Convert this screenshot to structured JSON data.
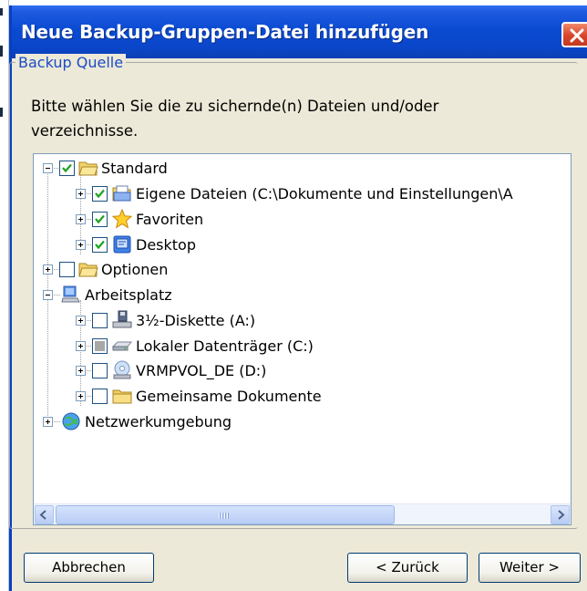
{
  "window": {
    "title": "Neue Backup-Gruppen-Datei hinzufügen",
    "close_icon": "close-icon"
  },
  "group": {
    "legend": "Backup Quelle",
    "instruction": "Bitte wählen Sie die zu sichernde(n) Dateien und/oder verzeichnisse."
  },
  "tree": {
    "items": [
      {
        "label": "Standard",
        "icon": "folder-open-icon",
        "expanded": true,
        "checked": "checked"
      },
      {
        "label": "Eigene Dateien (C:\\Dokumente und Einstellungen\\A",
        "icon": "my-documents-icon",
        "expanded": false,
        "checked": "checked"
      },
      {
        "label": "Favoriten",
        "icon": "favorites-star-icon",
        "expanded": false,
        "checked": "checked"
      },
      {
        "label": "Desktop",
        "icon": "desktop-icon",
        "expanded": false,
        "checked": "checked"
      },
      {
        "label": "Optionen",
        "icon": "folder-open-icon",
        "expanded": false,
        "checked": "unchecked"
      },
      {
        "label": "Arbeitsplatz",
        "icon": "computer-icon",
        "expanded": true
      },
      {
        "label": "3½-Diskette (A:)",
        "icon": "floppy-drive-icon",
        "expanded": false,
        "checked": "unchecked"
      },
      {
        "label": "Lokaler Datenträger (C:)",
        "icon": "hard-drive-icon",
        "expanded": false,
        "checked": "partial"
      },
      {
        "label": "VRMPVOL_DE (D:)",
        "icon": "cd-drive-icon",
        "expanded": false,
        "checked": "unchecked"
      },
      {
        "label": "Gemeinsame Dokumente",
        "icon": "folder-icon",
        "expanded": false,
        "checked": "unchecked"
      },
      {
        "label": "Netzwerkumgebung",
        "icon": "network-icon",
        "expanded": false
      }
    ]
  },
  "scrollbar": {
    "left_icon": "scroll-left-icon",
    "right_icon": "scroll-right-icon"
  },
  "buttons": {
    "cancel": "Abbrechen",
    "back": "< Zurück",
    "next": "Weiter >"
  },
  "colors": {
    "titlebar": "#0a4bd2",
    "dialog_bg": "#ece9d8",
    "legend_text": "#1c4cc4",
    "checkmark": "#1fa31f"
  }
}
